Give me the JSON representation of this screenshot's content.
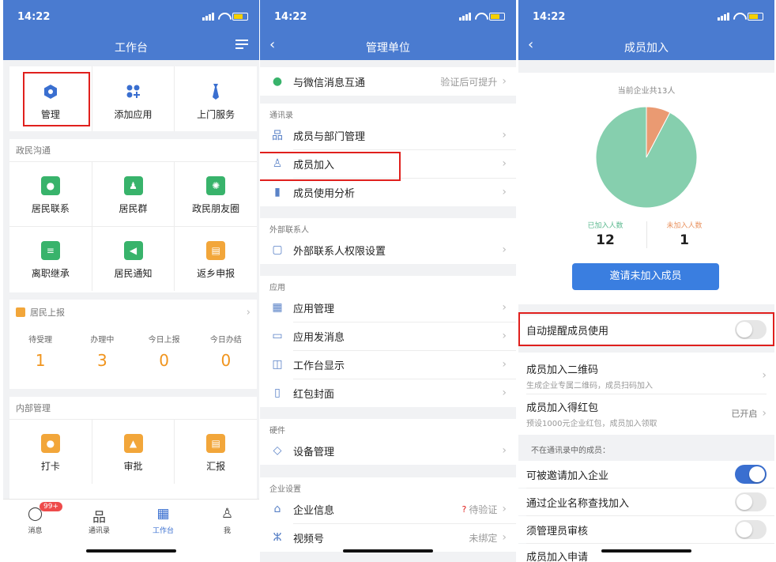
{
  "status_time": "14:22",
  "screen1": {
    "title": "工作台",
    "top_apps": [
      {
        "label": "管理",
        "icon": "hexagon-icon"
      },
      {
        "label": "添加应用",
        "icon": "add-apps-icon"
      },
      {
        "label": "上门服务",
        "icon": "tie-icon"
      }
    ],
    "section_gov": "政民沟通",
    "gov_apps": [
      {
        "label": "居民联系",
        "icon": "chat-icon"
      },
      {
        "label": "居民群",
        "icon": "group-icon"
      },
      {
        "label": "政民朋友圈",
        "icon": "aperture-icon"
      },
      {
        "label": "离职继承",
        "icon": "handover-icon"
      },
      {
        "label": "居民通知",
        "icon": "megaphone-icon"
      },
      {
        "label": "返乡申报",
        "icon": "report-icon"
      }
    ],
    "section_report": "居民上报",
    "stats": [
      {
        "label": "待受理",
        "value": "1"
      },
      {
        "label": "办理中",
        "value": "3"
      },
      {
        "label": "今日上报",
        "value": "0"
      },
      {
        "label": "今日办结",
        "value": "0"
      }
    ],
    "section_internal": "内部管理",
    "internal_apps": [
      {
        "label": "打卡",
        "icon": "location-icon"
      },
      {
        "label": "审批",
        "icon": "stamp-icon"
      },
      {
        "label": "汇报",
        "icon": "document-icon"
      }
    ],
    "tabs": [
      {
        "label": "消息",
        "badge": "99+"
      },
      {
        "label": "通讯录"
      },
      {
        "label": "工作台"
      },
      {
        "label": "我"
      }
    ]
  },
  "screen2": {
    "title": "管理单位",
    "wechat_row": {
      "label": "与微信消息互通",
      "right": "验证后可提升"
    },
    "group_contacts": "通讯录",
    "contacts_rows": [
      "成员与部门管理",
      "成员加入",
      "成员使用分析"
    ],
    "group_external": "外部联系人",
    "external_rows": [
      "外部联系人权限设置"
    ],
    "group_apps": "应用",
    "apps_rows": [
      "应用管理",
      "应用发消息",
      "工作台显示",
      "红包封面"
    ],
    "group_hardware": "硬件",
    "hardware_rows": [
      "设备管理"
    ],
    "group_enterprise": "企业设置",
    "enterprise_rows": [
      {
        "label": "企业信息",
        "right": "待验证"
      },
      {
        "label": "视频号",
        "right": "未绑定"
      }
    ]
  },
  "screen3": {
    "title": "成员加入",
    "total_label": "当前企业共13人",
    "pie": {
      "joined": 12,
      "not_joined": 1
    },
    "chart_colors": {
      "joined": "#86cfae",
      "not_joined": "#ea9a72"
    },
    "joined_label": "已加入人数",
    "not_joined_label": "未加入人数",
    "joined_value": "12",
    "not_joined_value": "1",
    "invite_button": "邀请未加入成员",
    "auto_remind": "自动提醒成员使用",
    "qr_title": "成员加入二维码",
    "qr_sub": "生成企业专属二维码，成员扫码加入",
    "redpack_title": "成员加入得红包",
    "redpack_sub": "预设1000元企业红包，成员加入领取",
    "redpack_status": "已开启",
    "not_in_contacts": "不在通讯录中的成员：",
    "toggle_rows": [
      {
        "label": "可被邀请加入企业",
        "on": true
      },
      {
        "label": "通过企业名称查找加入",
        "on": false
      },
      {
        "label": "须管理员审核",
        "on": false
      }
    ],
    "partial_row": "成员加入申请"
  }
}
